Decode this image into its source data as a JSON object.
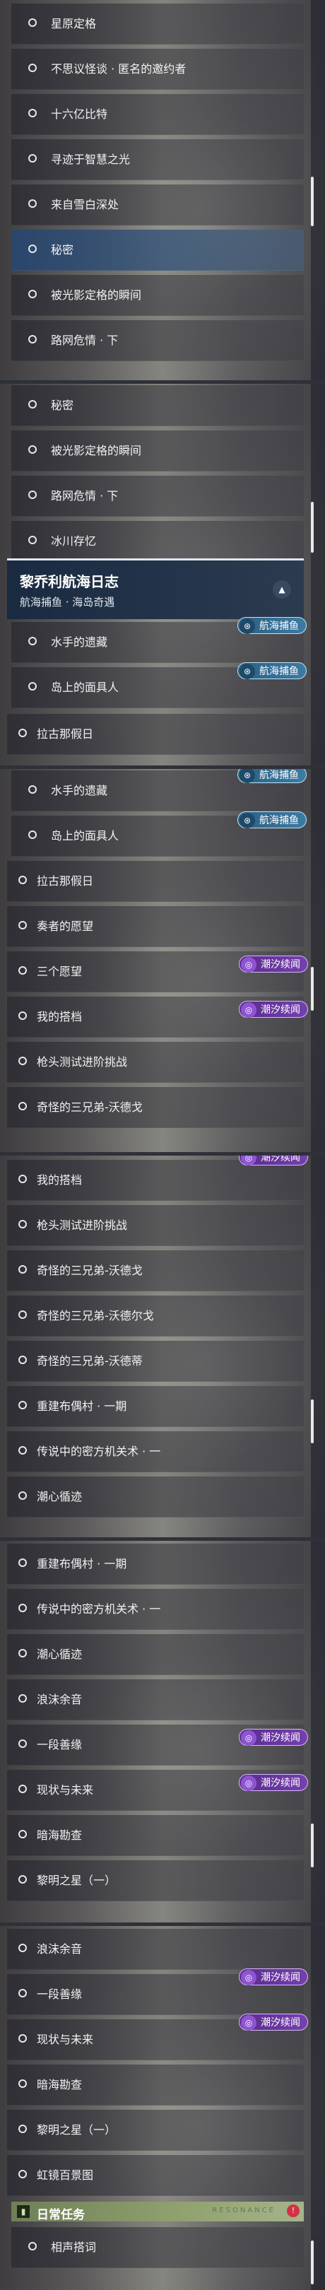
{
  "tags": {
    "fishing": "航海捕鱼",
    "tide": "潮汐续闻"
  },
  "icons": {
    "fishing_tag": "fish-icon",
    "tide_tag": "swirl-icon",
    "collapse": "chevron-up-icon",
    "daily": "book-icon",
    "badge": "notification-dot-icon"
  },
  "colors": {
    "selected_item": "#2e4a6e",
    "header": "#1e2e44",
    "fishing_tag": "#3c7ba4",
    "tide_tag": "#6a38a4",
    "daily_header": "#8ea06d",
    "badge": "#d23246"
  },
  "panel1": {
    "items": [
      "星原定格",
      "不思议怪谈 · 匿名的邀约者",
      "十六亿比特",
      "寻迹于智慧之光",
      "来自雪白深处",
      "秘密",
      "被光影定格的瞬间",
      "路网危情 · 下"
    ]
  },
  "panel2": {
    "items": [
      "秘密",
      "被光影定格的瞬间",
      "路网危情 · 下",
      "冰川存忆"
    ],
    "header": {
      "title": "黎乔利航海日志",
      "subtitle": "航海捕鱼 · 海岛奇遇"
    },
    "sub_items": [
      "水手的遗藏",
      "岛上的面具人"
    ],
    "top_items": [
      "拉古那假日"
    ]
  },
  "panel3": {
    "items": [
      "水手的遗藏",
      "岛上的面具人",
      "拉古那假日",
      "奏者的愿望",
      "三个愿望",
      "我的搭档",
      "枪头测试进阶挑战",
      "奇怪的三兄弟-沃德戈"
    ]
  },
  "panel4": {
    "items": [
      "我的搭档",
      "枪头测试进阶挑战",
      "奇怪的三兄弟-沃德戈",
      "奇怪的三兄弟-沃德尔戈",
      "奇怪的三兄弟-沃德蒂",
      "重建布偶村 · 一期",
      "传说中的密方机关术 · 一",
      "潮心循迹"
    ]
  },
  "panel5": {
    "items": [
      "重建布偶村 · 一期",
      "传说中的密方机关术 · 一",
      "潮心循迹",
      "浪沫余音",
      "一段善缘",
      "现状与未来",
      "暗海勘查",
      "黎明之星（一）"
    ]
  },
  "panel6": {
    "items": [
      "浪沫余音",
      "一段善缘",
      "现状与未来",
      "暗海勘查",
      "黎明之星（一）",
      "虹镜百景图"
    ],
    "daily": {
      "label": "日常任务",
      "decoration": "RESONANCE",
      "badge": "!"
    },
    "daily_items": [
      "相声搭词"
    ]
  }
}
